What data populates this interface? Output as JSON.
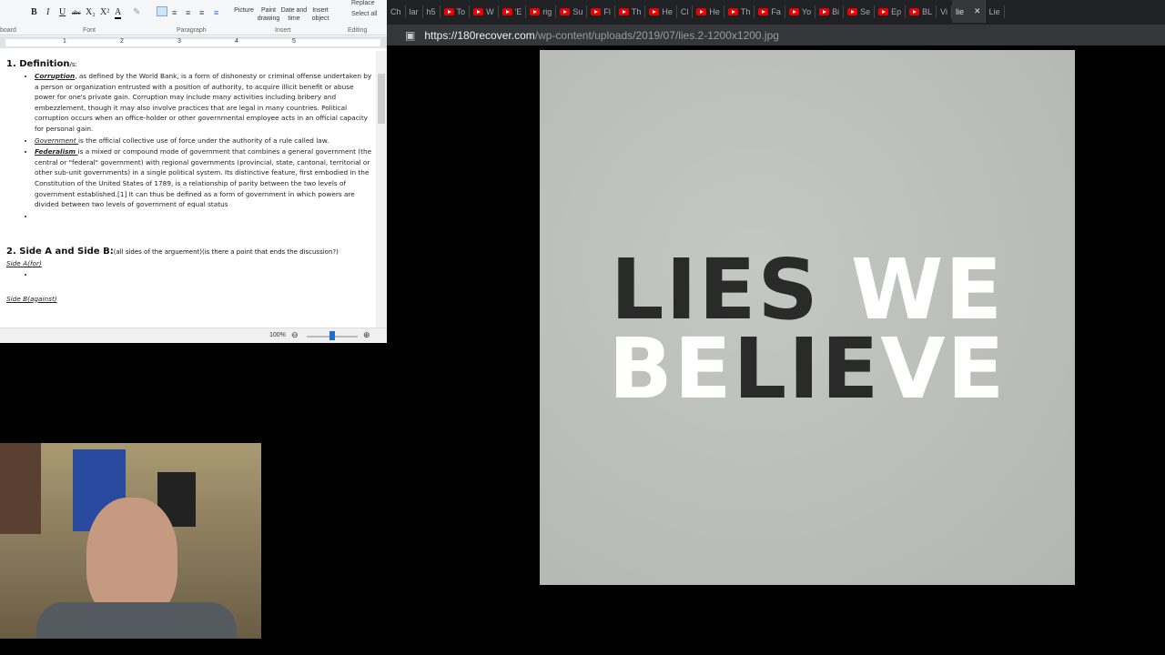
{
  "ribbon": {
    "groups": [
      "board",
      "Font",
      "Paragraph",
      "Insert",
      "Editing"
    ],
    "font_buttons": [
      "B",
      "I",
      "U",
      "abc",
      "X₂",
      "X²",
      "A",
      "✎"
    ],
    "insert": [
      "Picture",
      "Paint drawing",
      "Date and time",
      "Insert object"
    ],
    "editing": [
      "Replace",
      "Select all"
    ],
    "ruler_numbers": [
      "1",
      "2",
      "3",
      "4",
      "5"
    ]
  },
  "document": {
    "h1": "1. Definition",
    "h1_suffix": "/s:",
    "corruption_term": "Corruption",
    "corruption_text": ", as defined by the World Bank, is a form of dishonesty or criminal offense undertaken by a person or organization entrusted with a position of authority, to acquire illicit benefit or abuse power for one's private gain. Corruption may include many activities including bribery and embezzlement, though it may also involve practices that are legal in many countries. Political corruption occurs when an office-holder or other governmental employee acts in an official capacity for personal gain.",
    "government_term": "Government ",
    "government_text": "is the official collective use of force under the authority of a rule called law.",
    "federalism_term": "Federalism ",
    "federalism_text": "is a mixed or compound mode of government that combines a general government (the central or \"federal\" government) with regional governments (provincial, state, cantonal, territorial or other sub-unit governments) in a single political system. Its distinctive feature, first embodied in the Constitution of the United States of 1789, is a relationship of parity between the two levels of government established.[1] It can thus be defined as a form of government in which powers are divided between two levels of government of equal status",
    "h2": "2. Side A and Side B:",
    "h2_note": "(all sides of the arguement)(is there a point that ends the discussion?)",
    "side_a": "Side A(for)",
    "side_b": "Side B(against)"
  },
  "status": {
    "zoom": "100%",
    "zoom_level_percent": 100
  },
  "browser": {
    "tabs": [
      "Ch",
      "lar",
      "h5",
      "To",
      "W",
      "'E",
      "rig",
      "Su",
      "Fl",
      "Th",
      "He",
      "Cl",
      "He",
      "Th",
      "Fa",
      "Yo",
      "Bi",
      "Se",
      "Ep",
      "BL",
      "Vi",
      "lie",
      "Lie"
    ],
    "active_tab": "lie",
    "url_host": "https://180recover.com",
    "url_path": "/wp-content/uploads/2019/07/lies.2-1200x1200.jpg"
  },
  "image": {
    "line1_dark": "LIES ",
    "line1_light": "WE",
    "line2_light_a": "BE",
    "line2_dark": "LIE",
    "line2_light_b": "VE",
    "dark_color": "#2a2a2a",
    "light_color": "#ffffff"
  }
}
